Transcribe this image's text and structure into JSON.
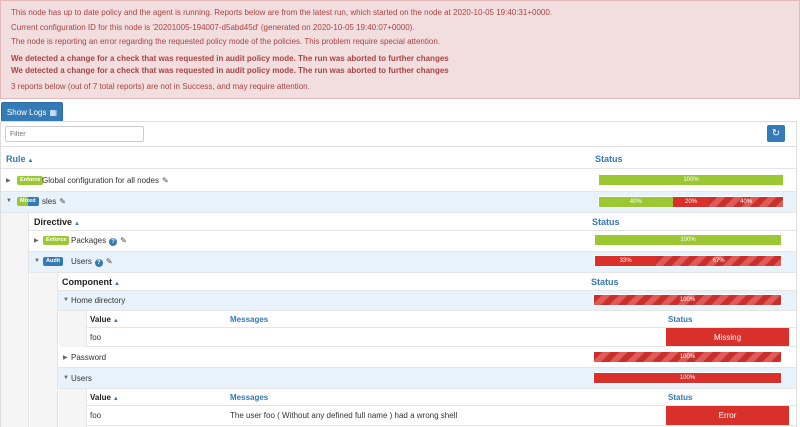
{
  "alert": {
    "line1": "This node has up to date policy and the agent is running. Reports below are from the latest run, which started on the node at 2020-10-05 19:40:31+0000.",
    "line2": "Current configuration ID for this node is '20201005-194007-d5abd45d' (generated on 2020-10-05 19:40:07+0000).",
    "line3": "The node is reporting an error regarding the requested policy mode of the policies. This problem require special attention.",
    "bold1": "We detected a change for a check that was requested in audit policy mode. The run was aborted to further changes",
    "bold2": "We detected a change for a check that was requested in audit policy mode. The run was aborted to further changes",
    "line4": "3 reports below (out of 7 total reports) are not in Success, and may require attention."
  },
  "toolbar": {
    "show_logs": "Show Logs",
    "filter_placeholder": "Filter"
  },
  "colors": {
    "success": "#9bc832",
    "error": "#d9302c",
    "primary": "#337ab7",
    "alert_bg": "#f2dede"
  },
  "table": {
    "rule_header": "Rule",
    "status_header": "Status",
    "rules": [
      {
        "badge": "Enforce",
        "name": "Global configuration for all nodes",
        "bar": [
          {
            "label": "100%",
            "kind": "green"
          }
        ]
      },
      {
        "badge": "Mixed",
        "name": "sles",
        "bar": [
          {
            "label": "40%",
            "kind": "green"
          },
          {
            "label": "20%",
            "kind": "red"
          },
          {
            "label": "40%",
            "kind": "stripe"
          }
        ]
      }
    ],
    "directive_header": "Directive",
    "directives": [
      {
        "badge": "Enforce",
        "name": "Packages",
        "bar": [
          {
            "label": "100%",
            "kind": "green"
          }
        ]
      },
      {
        "badge": "Audit",
        "name": "Users",
        "bar": [
          {
            "label": "33%",
            "kind": "red"
          },
          {
            "label": "67%",
            "kind": "stripe"
          }
        ]
      }
    ],
    "component_header": "Component",
    "components": [
      {
        "name": "Home directory",
        "bar": "100%"
      },
      {
        "name": "Password",
        "bar": "100%"
      },
      {
        "name": "Users",
        "bar": "100%"
      }
    ],
    "value_header": "Value",
    "messages_header": "Messages",
    "home_values": [
      {
        "value": "foo",
        "message": "",
        "status": "Missing"
      }
    ],
    "users_values": [
      {
        "value": "foo",
        "message": "The user foo ( Without any defined full name ) had a wrong shell",
        "status": "Error"
      }
    ]
  }
}
